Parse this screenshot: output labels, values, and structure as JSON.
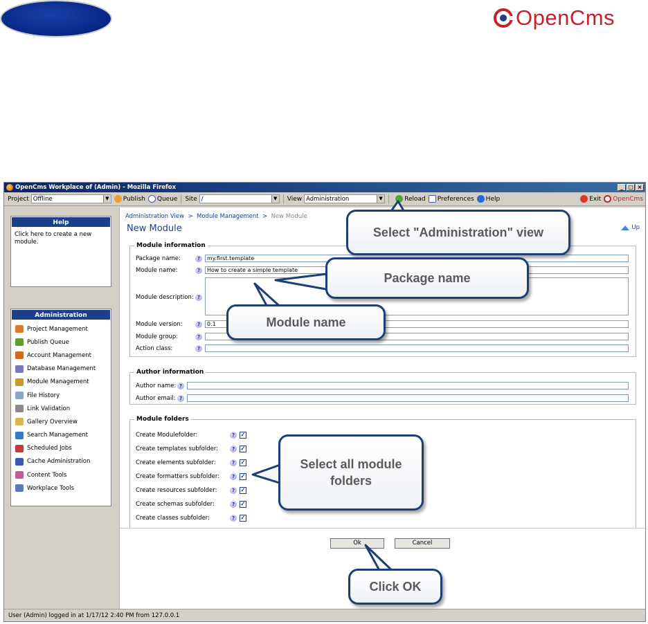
{
  "slide": {
    "logo_text": "OpenCms"
  },
  "window": {
    "title": "OpenCms Workplace of (Admin) - Mozilla Firefox",
    "controls": [
      "_",
      "□",
      "×"
    ]
  },
  "toolbar": {
    "project_label": "Project",
    "project_value": "Offline",
    "publish_label": "Publish",
    "queue_label": "Queue",
    "site_label": "Site",
    "site_value": "/",
    "view_label": "View",
    "view_value": "Administration",
    "reload_label": "Reload",
    "preferences_label": "Preferences",
    "help_label": "Help",
    "exit_label": "Exit",
    "brand": "OpenCms"
  },
  "help_panel": {
    "title": "Help",
    "text": "Click here to create a new module."
  },
  "admin_panel": {
    "title": "Administration",
    "items": [
      {
        "label": "Project Management",
        "color": "#e07a2a"
      },
      {
        "label": "Publish Queue",
        "color": "#5aa02c"
      },
      {
        "label": "Account Management",
        "color": "#d2691e"
      },
      {
        "label": "Database Management",
        "color": "#7a7ab8"
      },
      {
        "label": "Module Management",
        "color": "#c89a2a"
      },
      {
        "label": "File History",
        "color": "#8aa6c8"
      },
      {
        "label": "Link Validation",
        "color": "#8a8a8a"
      },
      {
        "label": "Gallery Overview",
        "color": "#d8b84a"
      },
      {
        "label": "Search Management",
        "color": "#3a78c8"
      },
      {
        "label": "Scheduled Jobs",
        "color": "#c83a3a"
      },
      {
        "label": "Cache Administration",
        "color": "#3a58b8"
      },
      {
        "label": "Content Tools",
        "color": "#c85a9a"
      },
      {
        "label": "Workplace Tools",
        "color": "#5a7ab8"
      }
    ]
  },
  "content": {
    "breadcrumb": [
      "Administration View",
      ">",
      "Module Management",
      ">",
      "New Module"
    ],
    "title": "New Module",
    "up_label": "Up",
    "module_info": {
      "legend": "Module information",
      "package_label": "Package name:",
      "package_value": "my.first.template",
      "module_name_label": "Module name:",
      "module_name_value": "How to create a simple template",
      "description_label": "Module description:",
      "version_label": "Module version:",
      "version_value": "0.1",
      "group_label": "Module group:",
      "action_label": "Action class:"
    },
    "author_info": {
      "legend": "Author information",
      "name_label": "Author name:",
      "email_label": "Author email:"
    },
    "module_folders": {
      "legend": "Module folders",
      "items": [
        "Create Modulefolder:",
        "Create templates subfolder:",
        "Create elements subfolder:",
        "Create formatters subfolder:",
        "Create resources subfolder:",
        "Create schemas subfolder:",
        "Create classes subfolder:"
      ],
      "check_mark": "✓"
    },
    "ok_label": "Ok",
    "cancel_label": "Cancel",
    "help_glyph": "?"
  },
  "status": {
    "text": "User (Admin) logged in at 1/17/12 2:40 PM from 127.0.0.1"
  },
  "callouts": {
    "view": "Select \"Administration\" view",
    "package": "Package name",
    "module": "Module name",
    "folders": "Select all module folders",
    "ok": "Click OK"
  }
}
